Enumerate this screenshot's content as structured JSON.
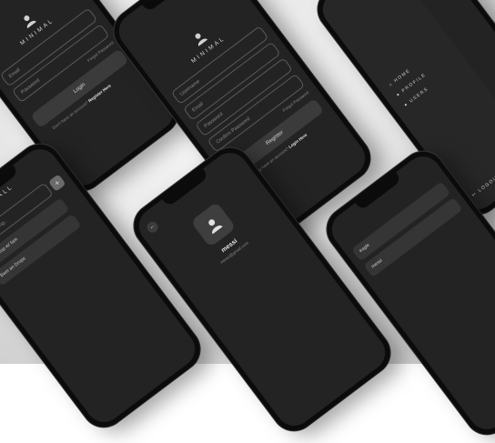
{
  "phones": {
    "login": {
      "brand": "MINIMAL",
      "email_placeholder": "Email",
      "password_placeholder": "Password",
      "login_label": "Login",
      "forgot_label": "Forgot Password",
      "prompt": "Don't have an account?",
      "register_link": "Register Here"
    },
    "register": {
      "brand": "MINIMAL",
      "username_placeholder": "Username",
      "email_placeholder": "Email",
      "password_placeholder": "Password",
      "confirm_placeholder": "Confirm Password",
      "register_label": "Register",
      "forgot_label": "Forgot Password",
      "prompt": "Already have an account?",
      "login_link": "Login Here"
    },
    "drawer": {
      "items": [
        "HOME",
        "PROFILE",
        "USERS"
      ],
      "logout_label": "LOGOUT"
    },
    "wall": {
      "title": "WALL",
      "input_placeholder": "Say something..",
      "posts": [
        "world cup w/ fam",
        "Bam an Drops"
      ],
      "add_symbol": "+"
    },
    "profile": {
      "name": "messi",
      "email": "messi@gmail.com"
    },
    "users": {
      "entries": [
        "eagle",
        "messi"
      ]
    }
  },
  "colors": {
    "screen": "#232323",
    "field_border": "#5a5a5a",
    "button": "#3b3b3b",
    "background": "#e4e4e4"
  }
}
